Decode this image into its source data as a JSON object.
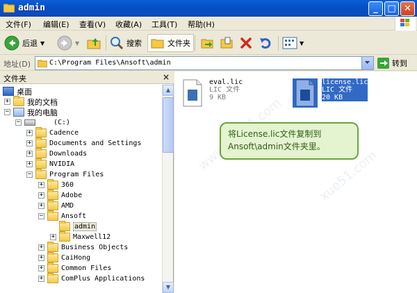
{
  "window": {
    "title": "admin",
    "buttons": {
      "minimize": "_",
      "maximize": "□",
      "close": "✕"
    }
  },
  "menu": {
    "items": [
      "文件(F)",
      "编辑(E)",
      "查看(V)",
      "收藏(A)",
      "工具(T)",
      "帮助(H)"
    ]
  },
  "toolbar": {
    "back_label": "后退",
    "search_label": "搜索",
    "folders_label": "文件夹"
  },
  "address": {
    "label": "地址(D)",
    "path": "C:\\Program Files\\Ansoft\\admin",
    "go_label": "转到"
  },
  "folder_pane": {
    "title": "文件夹",
    "close": "×",
    "tree": [
      {
        "label": "桌面"
      },
      {
        "label": "我的文档"
      },
      {
        "label": "我的电脑"
      },
      {
        "label": "(C:)"
      },
      {
        "label": "Cadence"
      },
      {
        "label": "Documents and Settings"
      },
      {
        "label": "Downloads"
      },
      {
        "label": "NVIDIA"
      },
      {
        "label": "Program Files"
      },
      {
        "label": "360"
      },
      {
        "label": "Adobe"
      },
      {
        "label": "AMD"
      },
      {
        "label": "Ansoft"
      },
      {
        "label": "admin"
      },
      {
        "label": "Maxwell12"
      },
      {
        "label": "Business Objects"
      },
      {
        "label": "CaiHong"
      },
      {
        "label": "Common Files"
      },
      {
        "label": "ComPlus Applications"
      }
    ]
  },
  "files": [
    {
      "name": "eval.lic",
      "type": "LIC 文件",
      "size": "9 KB"
    },
    {
      "name": "license.lic",
      "type": "LIC 文件",
      "size": "20 KB"
    }
  ],
  "callout": {
    "line1": "将License.lic文件复制到",
    "line2": "Ansoft\\admin文件夹里。"
  },
  "colors": {
    "titlebar": "#0a4cc0",
    "selection": "#316ac5",
    "callout_bg": "#e4f3d0",
    "callout_border": "#6aa43a"
  }
}
